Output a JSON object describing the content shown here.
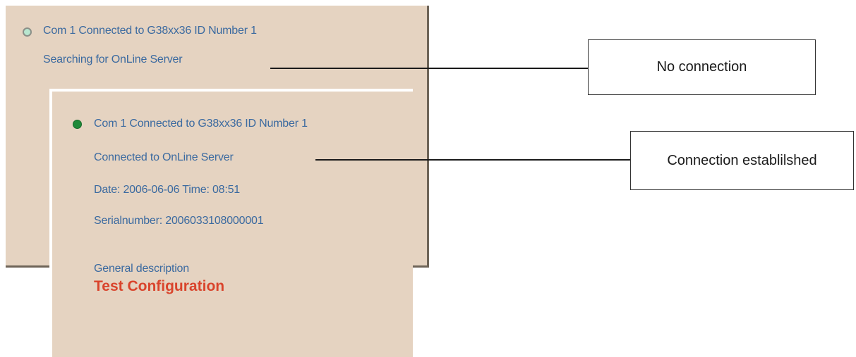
{
  "offline_window": {
    "status_led": "status-led-off",
    "connection_line": "Com 1 Connected to  G38xx36 ID Number 1",
    "server_status": "Searching for OnLine Server"
  },
  "online_window": {
    "status_led": "status-led-on",
    "connection_line": "Com 1 Connected to  G38xx36 ID Number 1",
    "server_status": "Connected to OnLine Server",
    "datetime": "Date: 2006-06-06  Time: 08:51",
    "serial": "Serialnumber: 2006033108000001",
    "description_label": "General description",
    "description_value": "Test Configuration"
  },
  "callouts": {
    "no_connection": "No connection",
    "connection_established": "Connection establilshed"
  },
  "colors": {
    "panel_background": "#e5d3c1",
    "text_blue": "#3b6aa0",
    "title_red": "#d9442c",
    "led_green": "#1f8a3a",
    "led_off": "#b8e6cf"
  }
}
